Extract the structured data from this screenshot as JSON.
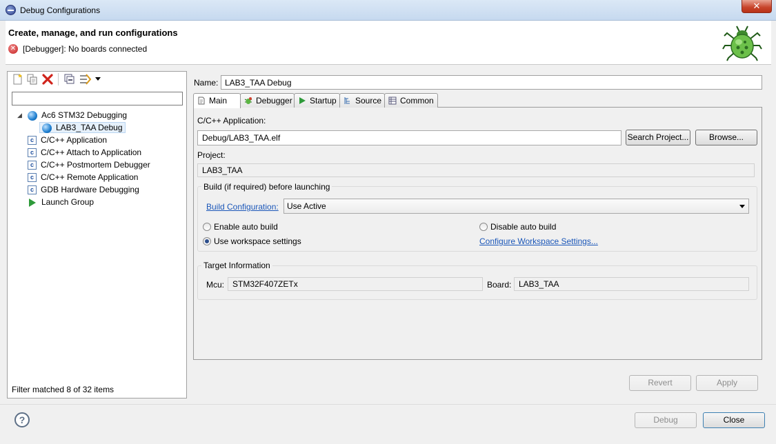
{
  "window": {
    "title": "Debug Configurations",
    "close_glyph": "✕"
  },
  "header": {
    "title": "Create, manage, and run configurations",
    "message": "[Debugger]: No boards connected",
    "error_icon": "x-circle-icon"
  },
  "left": {
    "filter_value": "",
    "toolbar": [
      "new-config-icon",
      "duplicate-icon",
      "delete-icon",
      "collapse-all-icon",
      "filter-icon"
    ],
    "tree": [
      {
        "label": "Ac6 STM32 Debugging",
        "icon": "globe-icon",
        "expanded": true
      },
      {
        "label": "LAB3_TAA Debug",
        "icon": "globe-icon",
        "selected": true
      },
      {
        "label": "C/C++ Application",
        "icon": "c-icon"
      },
      {
        "label": "C/C++ Attach to Application",
        "icon": "c-icon"
      },
      {
        "label": "C/C++ Postmortem Debugger",
        "icon": "c-icon"
      },
      {
        "label": "C/C++ Remote Application",
        "icon": "c-icon"
      },
      {
        "label": "GDB Hardware Debugging",
        "icon": "c-icon"
      },
      {
        "label": "Launch Group",
        "icon": "play-icon"
      }
    ],
    "status": "Filter matched 8 of 32 items"
  },
  "right": {
    "name_label": "Name:",
    "name_value": "LAB3_TAA Debug",
    "tabs": [
      {
        "label": "Main",
        "active": true
      },
      {
        "label": "Debugger"
      },
      {
        "label": "Startup"
      },
      {
        "label": "Source"
      },
      {
        "label": "Common"
      }
    ],
    "app_label": "C/C++ Application:",
    "app_value": "Debug/LAB3_TAA.elf",
    "search_project": "Search Project...",
    "browse": "Browse...",
    "project_label": "Project:",
    "project_value": "LAB3_TAA",
    "build": {
      "group_title": "Build (if required) before launching",
      "config_link": "Build Configuration:",
      "config_value": "Use Active",
      "enable_auto": "Enable auto build",
      "disable_auto": "Disable auto build",
      "use_workspace": "Use workspace settings",
      "selected": "use_workspace",
      "configure_link": "Configure Workspace Settings..."
    },
    "target": {
      "group_title": "Target Information",
      "mcu_label": "Mcu:",
      "mcu_value": "STM32F407ZETx",
      "board_label": "Board:",
      "board_value": "LAB3_TAA"
    },
    "revert": "Revert",
    "apply": "Apply"
  },
  "footer": {
    "help": "?",
    "debug": "Debug",
    "close": "Close"
  }
}
